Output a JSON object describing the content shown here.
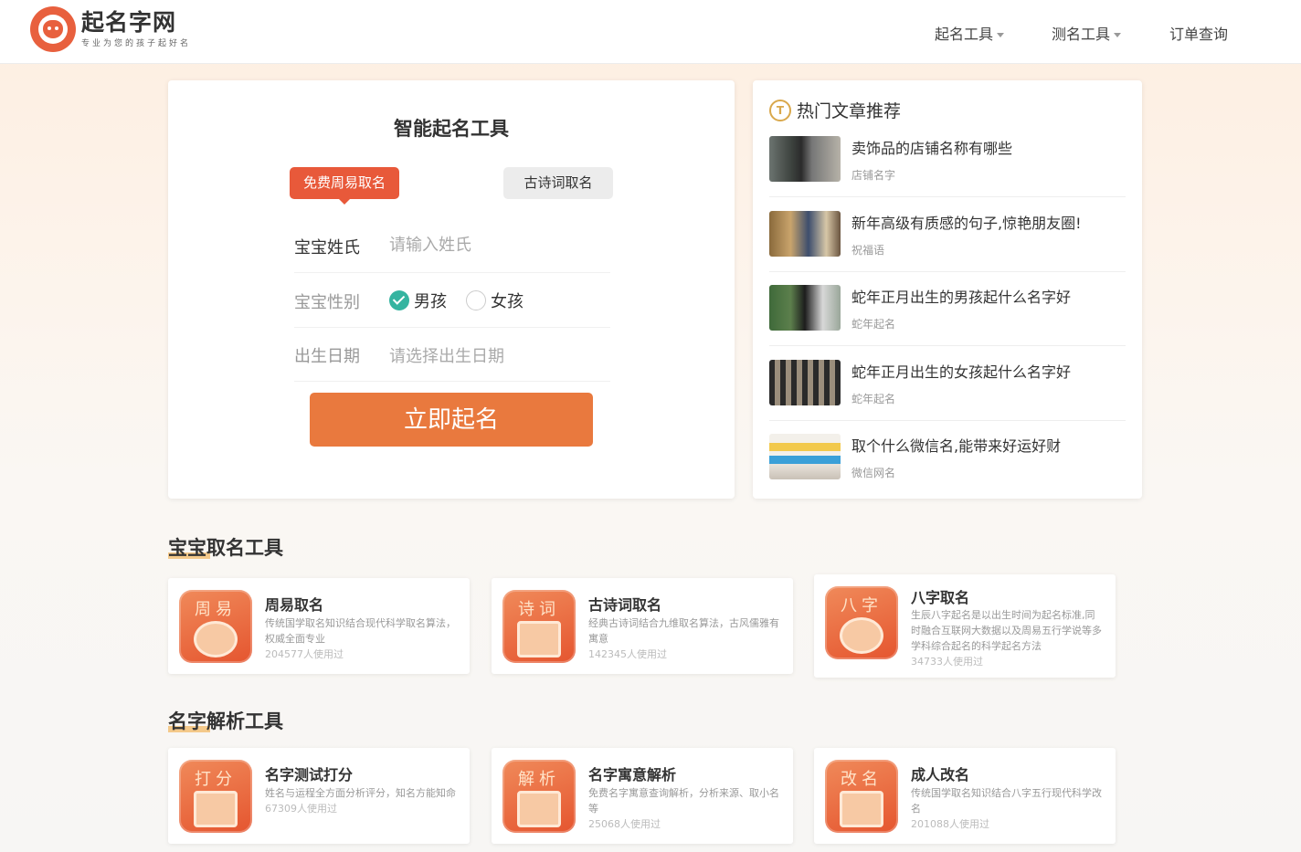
{
  "header": {
    "logo_title": "起名字网",
    "logo_sub": "专业为您的孩子起好名",
    "nav": [
      {
        "label": "起名工具",
        "has_caret": true
      },
      {
        "label": "测名工具",
        "has_caret": true
      },
      {
        "label": "订单查询",
        "has_caret": false
      }
    ]
  },
  "tool": {
    "title": "智能起名工具",
    "tab_active": "免费周易取名",
    "tab_inactive": "古诗词取名",
    "surname_label": "宝宝姓氏",
    "surname_placeholder": "请输入姓氏",
    "gender_label": "宝宝性别",
    "gender_boy": "男孩",
    "gender_girl": "女孩",
    "birth_label": "出生日期",
    "birth_placeholder": "请选择出生日期",
    "submit": "立即起名"
  },
  "articles": {
    "heading": "热门文章推荐",
    "items": [
      {
        "title": "卖饰品的店铺名称有哪些",
        "tag": "店铺名字"
      },
      {
        "title": "新年高级有质感的句子,惊艳朋友圈!",
        "tag": "祝福语"
      },
      {
        "title": "蛇年正月出生的男孩起什么名字好",
        "tag": "蛇年起名"
      },
      {
        "title": "蛇年正月出生的女孩起什么名字好",
        "tag": "蛇年起名"
      },
      {
        "title": "取个什么微信名,能带来好运好财",
        "tag": "微信网名"
      }
    ]
  },
  "baby_tools": {
    "heading": "宝宝取名工具",
    "items": [
      {
        "icon_word": "周易",
        "name": "周易取名",
        "desc": "传统国学取名知识结合现代科学取名算法，权威全面专业",
        "count": "204577人使用过"
      },
      {
        "icon_word": "诗词",
        "name": "古诗词取名",
        "desc": "经典古诗词结合九维取名算法，古风儒雅有寓意",
        "count": "142345人使用过"
      },
      {
        "icon_word": "八字",
        "name": "八字取名",
        "desc": "生辰八字起名是以出生时间为起名标准,同时融合互联网大数据以及周易五行学说等多学科综合起名的科学起名方法",
        "count": "34733人使用过"
      }
    ]
  },
  "analysis_tools": {
    "heading": "名字解析工具",
    "items": [
      {
        "icon_word": "打分",
        "name": "名字测试打分",
        "desc": "姓名与运程全方面分析评分，知名方能知命",
        "count": "67309人使用过"
      },
      {
        "icon_word": "解析",
        "name": "名字寓意解析",
        "desc": "免费名字寓意查询解析，分析来源、取小名等",
        "count": "25068人使用过"
      },
      {
        "icon_word": "改名",
        "name": "成人改名",
        "desc": "传统国学取名知识结合八字五行现代科学改名",
        "count": "201088人使用过"
      }
    ]
  }
}
